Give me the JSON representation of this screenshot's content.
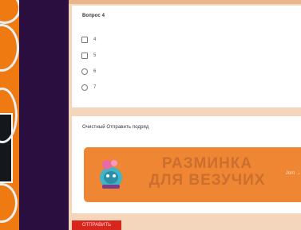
{
  "question": {
    "title": "Вопрос 4",
    "options": [
      "4",
      "5",
      "6",
      "7"
    ]
  },
  "promo": {
    "title": "Очистный Отправить подряд",
    "banner_line1": "РАЗМИНКА",
    "banner_line2": "ДЛЯ ВЕЗУЧИХ",
    "banner_link": "Jorп →"
  },
  "submit_label": "ОТПРАВИТЬ",
  "colors": {
    "background": "#f3d6bb",
    "sidebar": "#2a0e3f",
    "banner": "#ee8633",
    "submit": "#d7261e"
  }
}
